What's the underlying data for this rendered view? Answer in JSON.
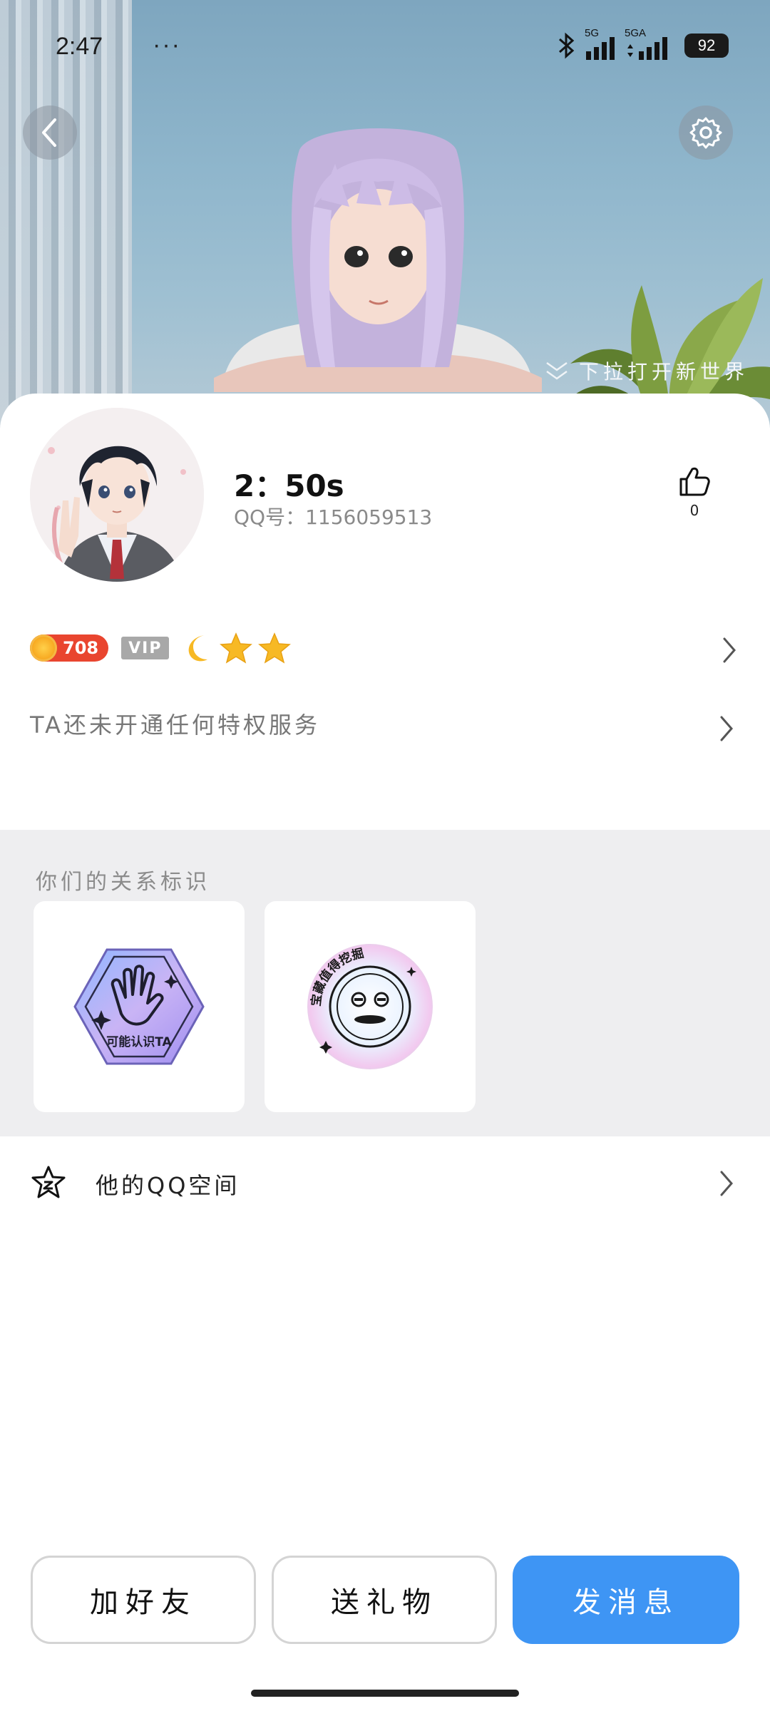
{
  "status_bar": {
    "time": "2:47",
    "dots": "···",
    "net1": "5G",
    "net2": "5GA",
    "battery": "92"
  },
  "hero": {
    "pull_hint": "下拉打开新世界"
  },
  "profile": {
    "nickname": "2：50s",
    "qq_number": "QQ号：1156059513",
    "like_count": "0"
  },
  "badges": {
    "coin_value": "708",
    "vip_label": "VIP"
  },
  "privilege": {
    "text": "TA还未开通任何特权服务"
  },
  "relationship": {
    "title": "你们的关系标识",
    "tags": [
      {
        "label": "可能认识TA",
        "icon": "wave-hand-hexagon-icon"
      },
      {
        "label": "宝藏值得挖掘",
        "icon": "smiley-holographic-seal-icon"
      }
    ]
  },
  "qzone": {
    "label": "他的QQ空间"
  },
  "actions": {
    "add_friend": "加好友",
    "send_gift": "送礼物",
    "send_message": "发消息"
  },
  "colors": {
    "primary_button": "#3e95f4",
    "coin_badge": "#e9452f",
    "section_bg": "#eeeef0"
  }
}
